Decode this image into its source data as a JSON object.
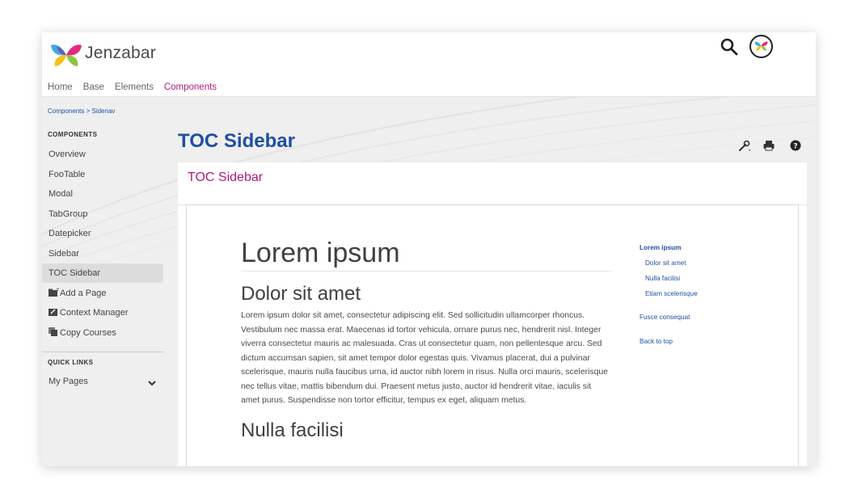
{
  "header": {
    "brand": "Jenzabar",
    "nav": [
      "Home",
      "Base",
      "Elements",
      "Components"
    ],
    "active_nav": "Components"
  },
  "breadcrumb": "Components > Sidenav",
  "sidebar": {
    "section1": "COMPONENTS",
    "items": [
      "Overview",
      "FooTable",
      "Modal",
      "TabGroup",
      "Datepicker",
      "Sidebar",
      "TOC Sidebar",
      "Add a Page",
      "Context Manager",
      "Copy Courses"
    ],
    "active": "TOC Sidebar",
    "section2": "QUICK LINKS",
    "quick_link": "My Pages"
  },
  "page": {
    "title": "TOC Sidebar",
    "panel_title": "TOC Sidebar"
  },
  "article": {
    "h1": "Lorem ipsum",
    "h2": "Dolor sit amet",
    "para": "Lorem ipsum dolor sit amet, consectetur adipiscing elit. Sed sollicitudin ullamcorper rhoncus. Vestibulum nec massa erat. Maecenas id tortor vehicula, ornare purus nec, hendrerit nisl. Integer viverra consectetur mauris ac malesuada. Cras ut consectetur quam, non pellentesque arcu. Sed dictum accumsan sapien, sit amet tempor dolor egestas quis. Vivamus placerat, dui a pulvinar scelerisque, mauris nulla faucibus urna, id auctor nibh lorem in risus. Nulla orci mauris, scelerisque nec tellus vitae, mattis bibendum dui. Praesent metus justo, auctor id hendrerit vitae, iaculis sit amet purus. Suspendisse non tortor efficitur, tempus ex eget, aliquam metus.",
    "h2b": "Nulla facilisi"
  },
  "toc": {
    "main": "Lorem ipsum",
    "sub": [
      "Dolor sit amet",
      "Nulla facilisi",
      "Etiam scelerisque"
    ],
    "fusce": "Fusce consequat",
    "back": "Back to top"
  },
  "colors": {
    "accent": "#b0197d",
    "link": "#1f4fa3"
  }
}
